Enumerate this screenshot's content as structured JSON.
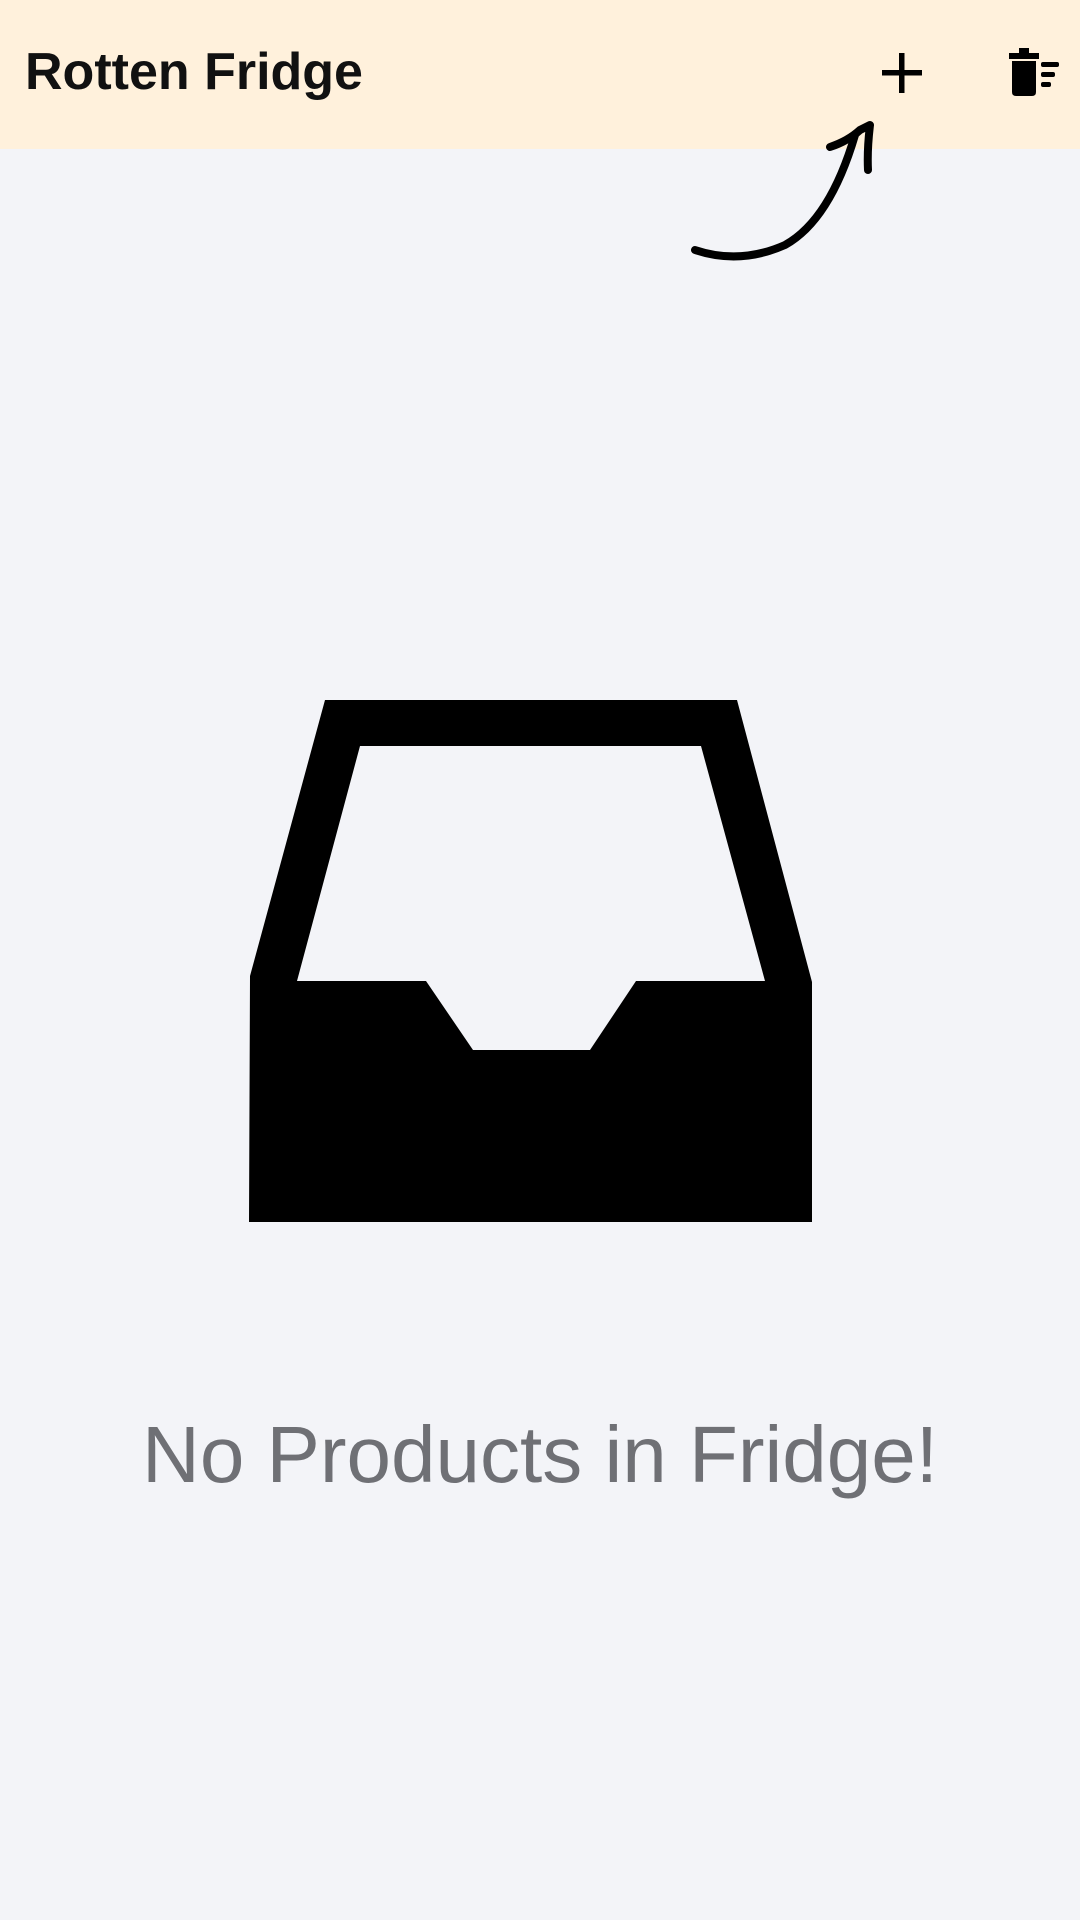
{
  "app_bar": {
    "title": "Rotten Fridge",
    "background_color": "#fff1dc",
    "actions": [
      {
        "name": "add",
        "icon": "plus-icon"
      },
      {
        "name": "delete-all",
        "icon": "delete-sweep-icon"
      }
    ]
  },
  "hint": {
    "icon": "curved-arrow-icon",
    "points_to": "add"
  },
  "empty_state": {
    "icon": "inbox-tray-icon",
    "message": "No Products in Fridge!",
    "message_color": "#6f7075"
  },
  "page_background_color": "#f3f4f8"
}
